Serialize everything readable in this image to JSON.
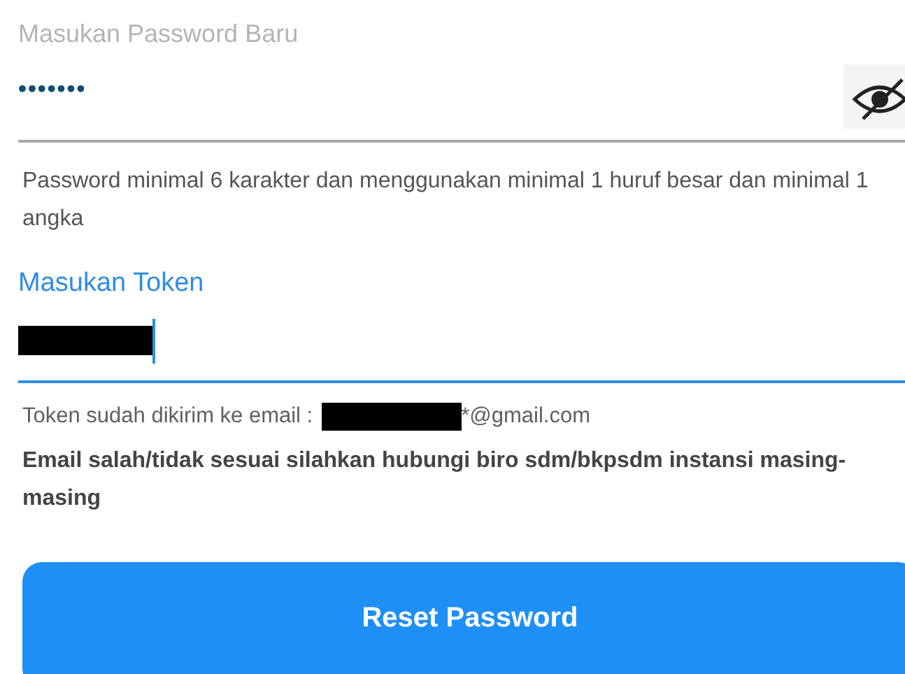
{
  "password_field": {
    "placeholder": "Masukan Password Baru",
    "value": "•••••••",
    "password_visible": false
  },
  "password_hint": "Password minimal 6 karakter dan menggunakan minimal 1 huruf besar dan minimal 1 angka",
  "token_field": {
    "label": "Masukan Token",
    "focused": true,
    "value_redacted": true
  },
  "token_sent": {
    "prefix": "Token sudah dikirim ke email :",
    "email_redacted": true,
    "suffix": "*@gmail.com"
  },
  "email_notice": "Email salah/tidak sesuai silahkan hubungi biro sdm/bkpsdm instansi masing-masing",
  "submit_button": "Reset Password"
}
